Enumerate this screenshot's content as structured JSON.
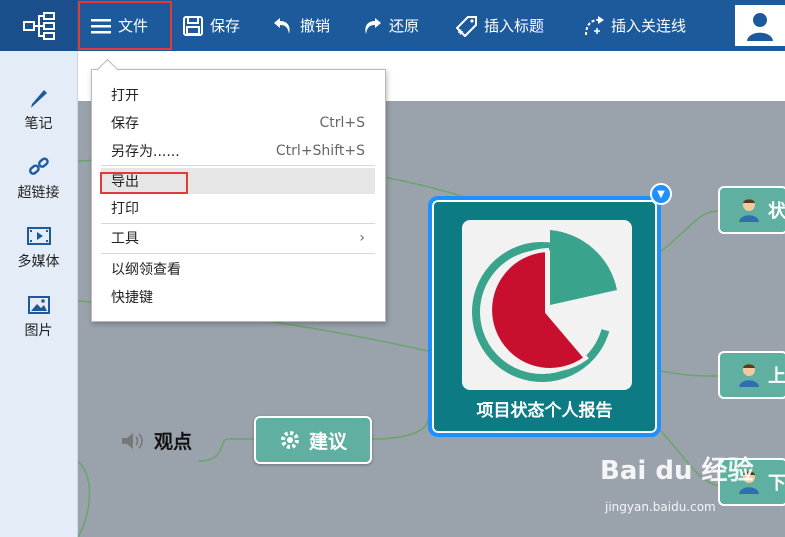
{
  "toolbar": {
    "file_label": "文件",
    "save_label": "保存",
    "undo_label": "撤销",
    "redo_label": "还原",
    "insert_title_label": "插入标题",
    "insert_link_label": "插入关连线"
  },
  "sidebar": {
    "items": [
      {
        "label": "笔记",
        "icon": "pencil-icon"
      },
      {
        "label": "超链接",
        "icon": "link-icon"
      },
      {
        "label": "多媒体",
        "icon": "media-icon"
      },
      {
        "label": "图片",
        "icon": "image-icon"
      }
    ]
  },
  "file_menu": {
    "items": [
      {
        "label": "打开",
        "shortcut": ""
      },
      {
        "label": "保存",
        "shortcut": "Ctrl+S"
      },
      {
        "label": "另存为......",
        "shortcut": "Ctrl+Shift+S"
      },
      {
        "label": "导出",
        "shortcut": ""
      },
      {
        "label": "打印",
        "shortcut": ""
      },
      {
        "label": "工具",
        "shortcut": "›"
      },
      {
        "label": "以纲领查看",
        "shortcut": ""
      },
      {
        "label": "快捷键",
        "shortcut": ""
      }
    ]
  },
  "mindmap": {
    "central_title": "项目状态个人报告",
    "suggestion_label": "建议",
    "viewpoint_label": "观点",
    "right_nodes": [
      "状",
      "上",
      "下"
    ]
  },
  "watermark": {
    "brand": "Bai du 经验",
    "url": "jingyan.baidu.com"
  },
  "colors": {
    "toolbar": "#1d5a9c",
    "node_teal": "#5fb0a0",
    "central_bg": "#0c7b83",
    "highlight_red": "#e23a36",
    "selection_blue": "#1e90ff",
    "pie_red": "#c8102e",
    "pie_teal": "#3aa38c"
  }
}
